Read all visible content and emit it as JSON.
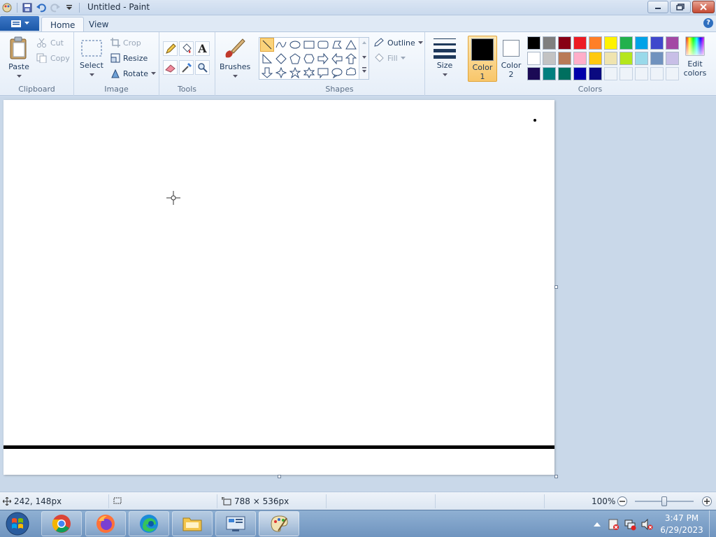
{
  "window": {
    "title": "Untitled - Paint"
  },
  "tabs": [
    {
      "label": "Home"
    },
    {
      "label": "View"
    }
  ],
  "ribbon": {
    "clipboard": {
      "group_label": "Clipboard",
      "paste_label": "Paste",
      "cut_label": "Cut",
      "copy_label": "Copy"
    },
    "image": {
      "group_label": "Image",
      "select_label": "Select",
      "crop_label": "Crop",
      "resize_label": "Resize",
      "rotate_label": "Rotate"
    },
    "tools": {
      "group_label": "Tools"
    },
    "brushes": {
      "label": "Brushes"
    },
    "shapes": {
      "group_label": "Shapes",
      "outline_label": "Outline",
      "fill_label": "Fill"
    },
    "size": {
      "label": "Size"
    },
    "colors": {
      "group_label": "Colors",
      "color1_label": "Color",
      "color1_num": "1",
      "color2_label": "Color",
      "color2_num": "2",
      "edit_label": "Edit",
      "edit_label2": "colors",
      "color1_value": "#000000",
      "color2_value": "#ffffff",
      "palette": [
        [
          "#000000",
          "#7f7f7f",
          "#880015",
          "#ed1c24",
          "#ff7f27",
          "#fff200",
          "#22b14c",
          "#00a2e8",
          "#3f48cc",
          "#a349a4"
        ],
        [
          "#ffffff",
          "#c3c3c3",
          "#b97a57",
          "#ffaec9",
          "#ffc90e",
          "#efe4b0",
          "#b5e61d",
          "#99d9ea",
          "#7092be",
          "#c8bfe7"
        ],
        [
          "#1b0a55",
          "#007f7f",
          "#006f5f",
          "#0000aa",
          "#0a0a80",
          "",
          "",
          "",
          "",
          ""
        ]
      ]
    }
  },
  "status": {
    "cursor_pos": "242, 148px",
    "canvas_size": "788 × 536px",
    "zoom": "100%",
    "zoom_fraction": 0.5
  },
  "taskbar": {
    "time": "3:47 PM",
    "date": "6/29/2023"
  }
}
